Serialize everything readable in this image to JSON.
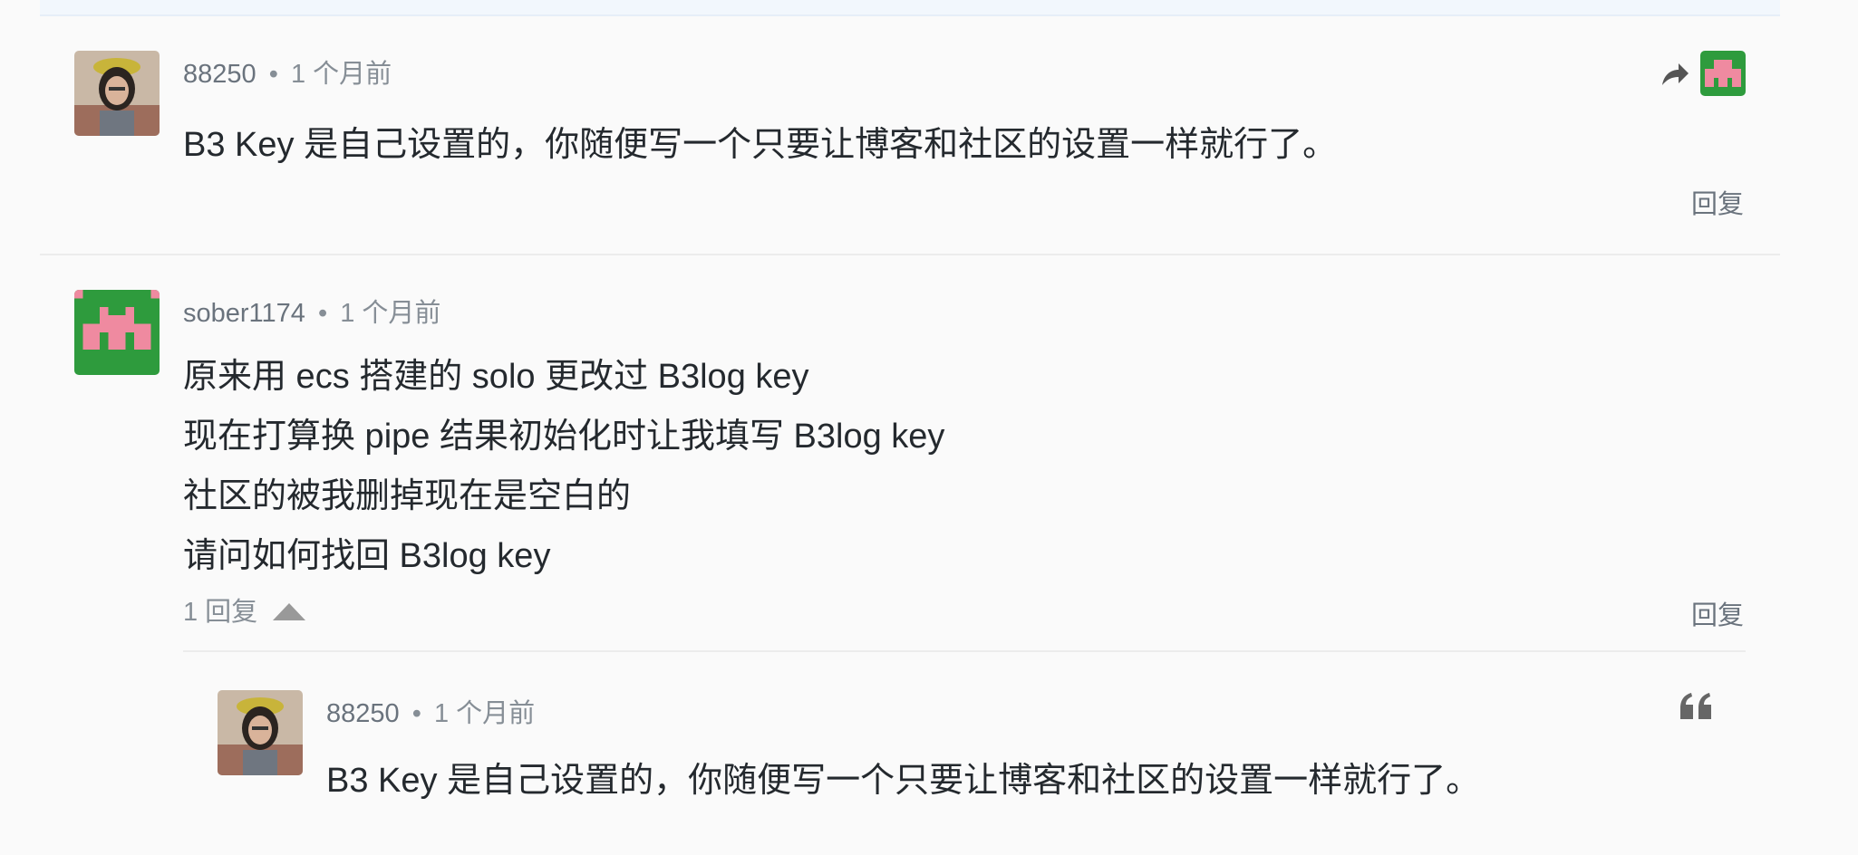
{
  "comments": [
    {
      "author": "88250",
      "time": "1 个月前",
      "lines": [
        "B3 Key 是自己设置的，你随便写一个只要让博客和社区的设置一样就行了。"
      ],
      "reply_label": "回复"
    },
    {
      "author": "sober1174",
      "time": "1 个月前",
      "lines": [
        "原来用 ecs 搭建的 solo 更改过 B3log key",
        "现在打算换 pipe 结果初始化时让我填写 B3log key",
        "社区的被我删掉现在是空白的",
        "请问如何找回 B3log key"
      ],
      "replies_count_label": "1 回复",
      "reply_label": "回复"
    }
  ],
  "nested_reply": {
    "author": "88250",
    "time": "1 个月前",
    "text": "B3 Key 是自己设置的，你随便写一个只要让博客和社区的设置一样就行了。"
  },
  "separator": "•",
  "icons": {
    "share": "share-arrow-icon",
    "quote": "quote-icon",
    "collapse": "caret-up-icon"
  },
  "colors": {
    "meta": "#868e96",
    "text": "#24292e",
    "pixel_avatar_bg": "#2e9b3d",
    "pixel_avatar_fg": "#ef8aa0"
  }
}
